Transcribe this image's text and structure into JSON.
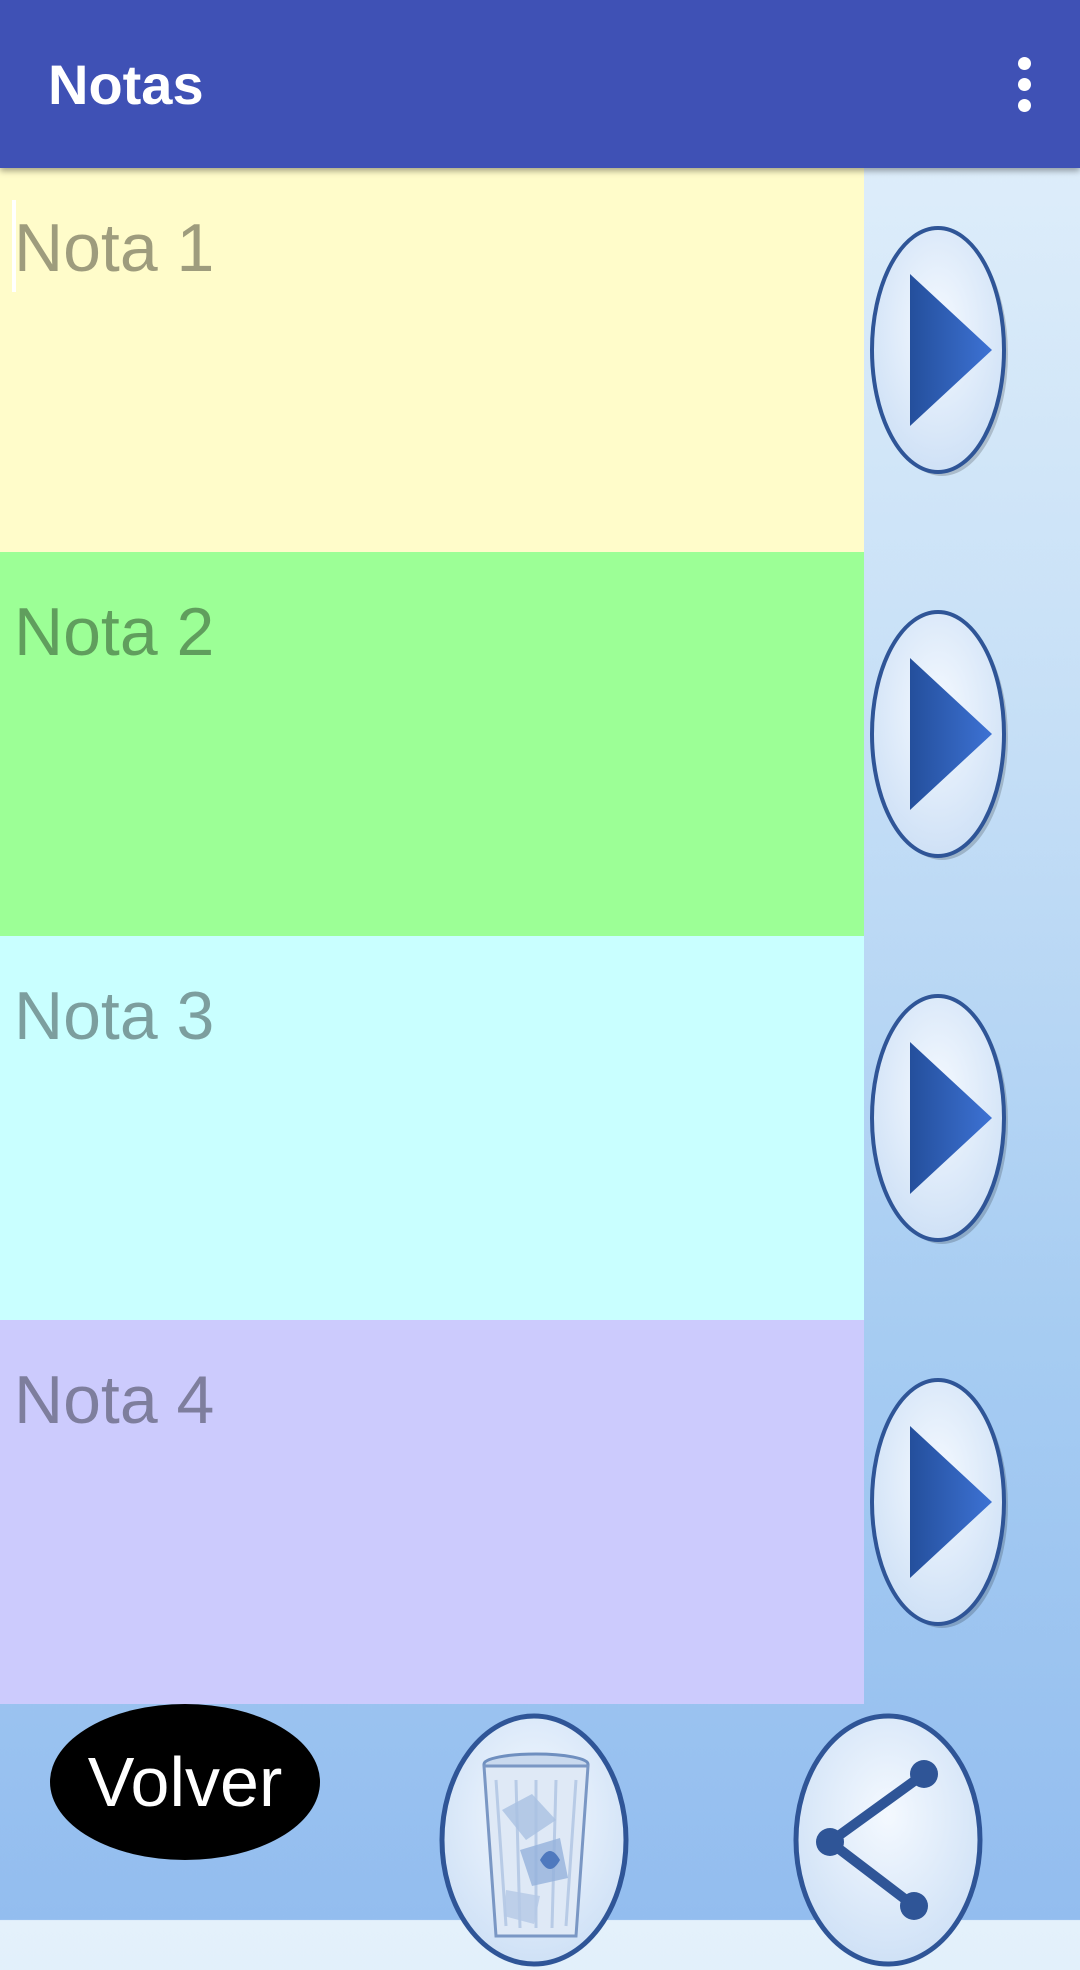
{
  "appbar": {
    "title": "Notas",
    "menu_icon": "more-vert-icon"
  },
  "notes": [
    {
      "placeholder": "Nota 1",
      "color": "#fffcca",
      "open_icon": "play-icon"
    },
    {
      "placeholder": "Nota 2",
      "color": "#9cff96",
      "open_icon": "play-icon"
    },
    {
      "placeholder": "Nota 3",
      "color": "#c9ffff",
      "open_icon": "play-icon"
    },
    {
      "placeholder": "Nota 4",
      "color": "#cccbfd",
      "open_icon": "play-icon"
    }
  ],
  "footer": {
    "back_label": "Volver",
    "delete_icon": "recycle-bin-icon",
    "share_icon": "share-icon"
  },
  "colors": {
    "appbar": "#3f51b5",
    "button_outline": "#2f5597",
    "button_fill": "#dce9f8",
    "arrow": "#2e59b0"
  }
}
